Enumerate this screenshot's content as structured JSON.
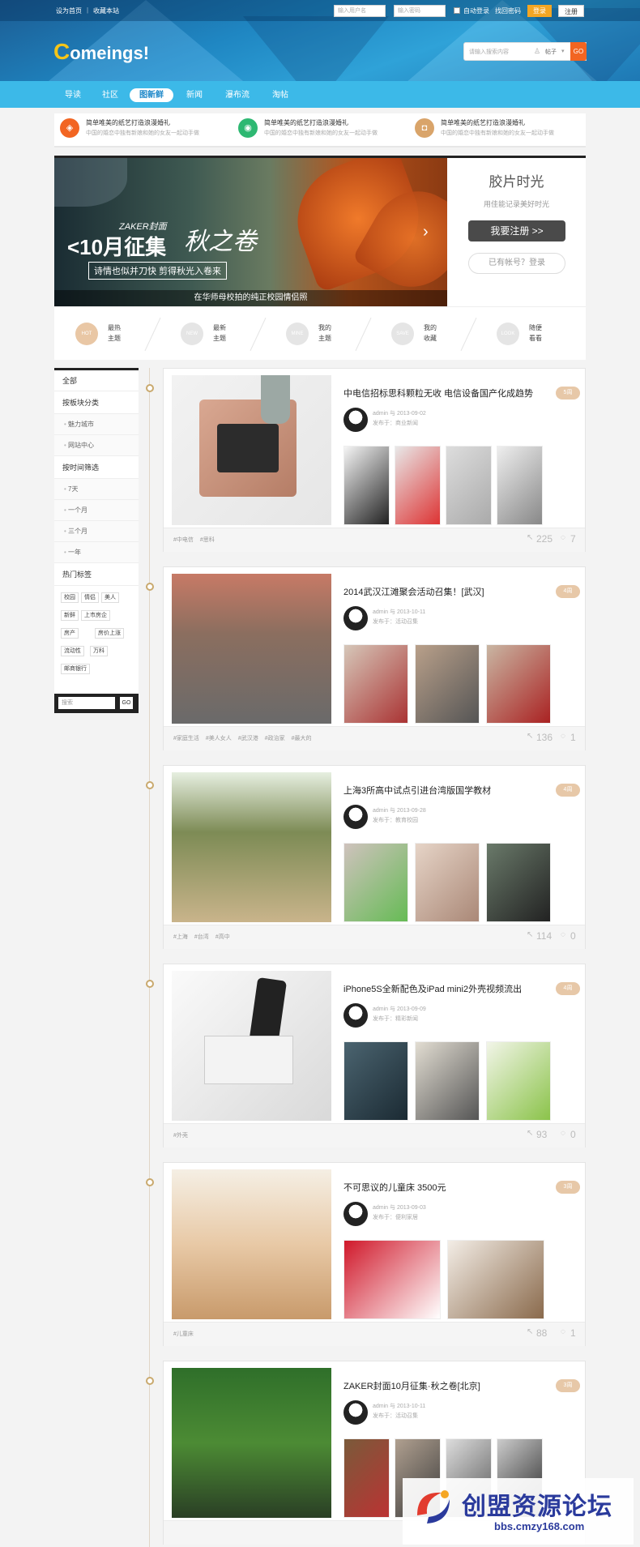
{
  "topbar": {
    "set_home": "设为首页",
    "bookmark": "收藏本站",
    "username_ph": "输入用户名",
    "password_ph": "输入密码",
    "auto_login": "自动登录",
    "forgot": "找回密码",
    "login": "登录",
    "register": "注册"
  },
  "header": {
    "logo_c": "C",
    "logo_rest": "omeings!",
    "search_ph": "请输入搜索内容",
    "search_type": "帖子",
    "search_btn": "GO"
  },
  "nav": [
    "导读",
    "社区",
    "图新鲜",
    "新闻",
    "瀑布流",
    "淘帖"
  ],
  "nav_active": 2,
  "promo": [
    {
      "title": "简单唯美的纸艺打造浪漫婚礼",
      "sub": "中国的婚恋中独有新娘和她的女友一起动手做"
    },
    {
      "title": "简单唯美的纸艺打造浪漫婚礼",
      "sub": "中国的婚恋中独有新娘和她的女友一起动手做"
    },
    {
      "title": "简单唯美的纸艺打造浪漫婚礼",
      "sub": "中国的婚恋中独有新娘和她的女友一起动手做"
    }
  ],
  "banner": {
    "zaker": "ZAKER封面",
    "month": "<10月征集",
    "script": "秋之卷",
    "tag": "诗情也似并刀快 剪得秋光入卷来",
    "caption": "在华师母校拍的纯正校园情侣照"
  },
  "register": {
    "title": "胶片时光",
    "sub": "用佳能记录美好时光",
    "btn": "我要注册 >>",
    "login": "已有帐号？登录"
  },
  "quick": [
    {
      "icon": "HOT",
      "l1": "最热",
      "l2": "主题",
      "color": "#e9c7a5"
    },
    {
      "icon": "NEW",
      "l1": "最新",
      "l2": "主题",
      "color": "#e5e5e5"
    },
    {
      "icon": "MINE",
      "l1": "我的",
      "l2": "主题",
      "color": "#e5e5e5"
    },
    {
      "icon": "SAVE",
      "l1": "我的",
      "l2": "收藏",
      "color": "#e5e5e5"
    },
    {
      "icon": "LOOK",
      "l1": "随便",
      "l2": "看看",
      "color": "#e5e5e5"
    }
  ],
  "sidebar": {
    "all": "全部",
    "by_block": "按板块分类",
    "blocks": [
      "魅力城市",
      "网站中心"
    ],
    "by_time": "按时间筛选",
    "times": [
      "7天",
      "一个月",
      "三个月",
      "一年"
    ],
    "hot_tags": "热门标签",
    "tags": [
      "校园",
      "情侣",
      "美人",
      "新鲜",
      "上市房企",
      "房产",
      "房价上涨",
      "流动性",
      "万科",
      "邮商银行"
    ],
    "search_ph": "搜索",
    "go": "GO"
  },
  "posts": [
    {
      "title": "中电信招标思科颗粒无收 电信设备国产化成趋势",
      "badge": "5周",
      "author": "admin 与 2013-09-02",
      "section": "发布于：商业新闻",
      "tags": [
        "#中电信",
        "#思科"
      ],
      "views": "225",
      "comments": "7"
    },
    {
      "title": "2014武汉江滩聚会活动召集！[武汉]",
      "badge": "4周",
      "author": "admin 与 2013-10-11",
      "section": "发布于：活动召集",
      "tags": [
        "#家庭生活",
        "#美人女人",
        "#武汉港",
        "#政治家",
        "#最大的"
      ],
      "views": "136",
      "comments": "1"
    },
    {
      "title": "上海3所高中试点引进台湾版国学教材",
      "badge": "4周",
      "author": "admin 与 2013-09-28",
      "section": "发布于：教育校园",
      "tags": [
        "#上海",
        "#台湾",
        "#高中"
      ],
      "views": "114",
      "comments": "0"
    },
    {
      "title": "iPhone5S全新配色及iPad mini2外壳视频流出",
      "badge": "4周",
      "author": "admin 与 2013-09-09",
      "section": "发布于：精彩新闻",
      "tags": [
        "#外壳"
      ],
      "views": "93",
      "comments": "0"
    },
    {
      "title": "不可思议的儿童床 3500元",
      "badge": "3周",
      "author": "admin 与 2013-09-03",
      "section": "发布于：便利家居",
      "tags": [
        "#儿童床"
      ],
      "views": "88",
      "comments": "1"
    },
    {
      "title": "ZAKER封面10月征集·秋之卷[北京]",
      "badge": "3周",
      "author": "admin 与 2013-10-11",
      "section": "发布于：活动召集",
      "tags": [],
      "views": "",
      "comments": ""
    }
  ],
  "watermark": {
    "title": "创盟资源论坛",
    "url": "bbs.cmzy168.com"
  }
}
